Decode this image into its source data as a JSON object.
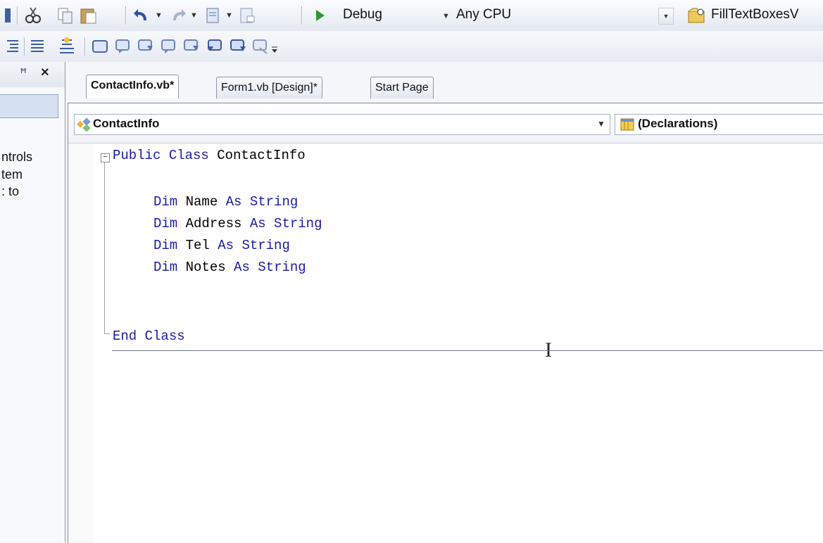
{
  "toolbar": {
    "configuration": "Debug",
    "platform": "Any CPU",
    "startup_project": "FillTextBoxesV"
  },
  "toolwindow": {
    "pin_glyph": "1",
    "close_glyph": "×",
    "text_lines": [
      "ntrols",
      "tem",
      ": to"
    ]
  },
  "tabs": [
    {
      "label": "ContactInfo.vb*",
      "active": true
    },
    {
      "label": "Form1.vb [Design]*",
      "active": false
    },
    {
      "label": "Start Page",
      "active": false
    }
  ],
  "navbar": {
    "class_name": "ContactInfo",
    "member_name": "(Declarations)"
  },
  "code": {
    "line1_kw": "Public Class",
    "line1_name": " ContactInfo",
    "decls": [
      {
        "dim": "Dim",
        "name": " Name ",
        "as": "As",
        "type": " String"
      },
      {
        "dim": "Dim",
        "name": " Address ",
        "as": "As",
        "type": " String"
      },
      {
        "dim": "Dim",
        "name": " Tel ",
        "as": "As",
        "type": " String"
      },
      {
        "dim": "Dim",
        "name": " Notes ",
        "as": "As",
        "type": " String"
      }
    ],
    "end_line": "End Class"
  },
  "colors": {
    "keyword": "#1a1aa6",
    "change_bar": "#f1df7f"
  }
}
